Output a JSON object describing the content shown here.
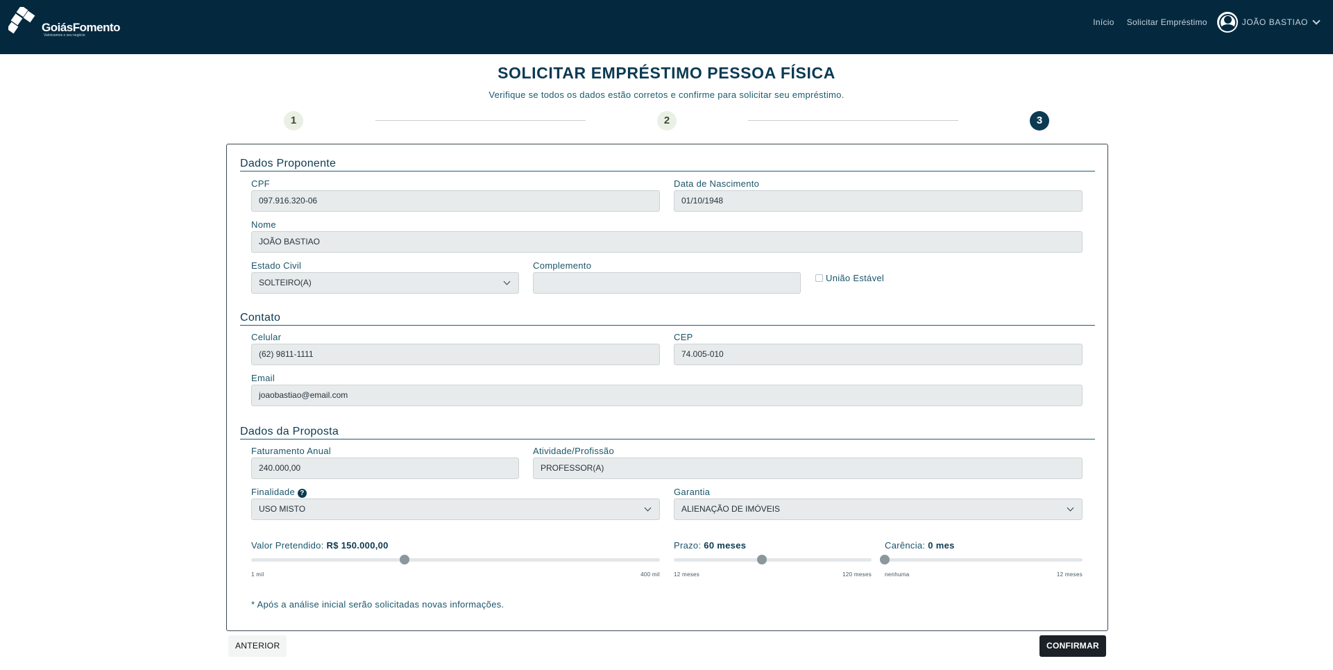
{
  "header": {
    "logo_text": "GoiásFomento",
    "logo_tagline": "Valorizamos o seu negócio",
    "nav": {
      "home": "Início",
      "request_loan": "Solicitar Empréstimo"
    },
    "user_name": "JOÃO BASTIAO"
  },
  "page": {
    "title": "SOLICITAR EMPRÉSTIMO PESSOA FÍSICA",
    "subtitle": "Verifique se todos os dados estão corretos e confirme para solicitar seu empréstimo."
  },
  "stepper": {
    "steps": [
      "1",
      "2",
      "3"
    ],
    "active": "3"
  },
  "proponente": {
    "section_title": "Dados Proponente",
    "cpf_label": "CPF",
    "cpf": "097.916.320-06",
    "nascimento_label": "Data de Nascimento",
    "nascimento": "01/10/1948",
    "nome_label": "Nome",
    "nome": "JOÃO BASTIAO",
    "estado_civil_label": "Estado Civil",
    "estado_civil": "SOLTEIRO(A)",
    "complemento_label": "Complemento",
    "complemento": "",
    "uniao_estavel_label": "União Estável"
  },
  "contato": {
    "section_title": "Contato",
    "celular_label": "Celular",
    "celular": "(62) 9811-1111",
    "cep_label": "CEP",
    "cep": "74.005-010",
    "email_label": "Email",
    "email": "joaobastiao@email.com"
  },
  "proposta": {
    "section_title": "Dados da Proposta",
    "faturamento_label": "Faturamento Anual",
    "faturamento": "240.000,00",
    "atividade_label": "Atividade/Profissão",
    "atividade": "PROFESSOR(A)",
    "finalidade_label": "Finalidade",
    "finalidade": "USO MISTO",
    "garantia_label": "Garantia",
    "garantia": "ALIENAÇÃO DE IMÓVEIS",
    "valor_label": "Valor Pretendido:",
    "valor": "R$ 150.000,00",
    "valor_min": "1 mil",
    "valor_max": "400 mil",
    "valor_position": 0.375,
    "prazo_label": "Prazo:",
    "prazo": "60 meses",
    "prazo_min": "12 meses",
    "prazo_max": "120 meses",
    "prazo_position": 0.444,
    "carencia_label": "Carência:",
    "carencia": "0 mes",
    "carencia_min": "nenhuma",
    "carencia_max": "12 meses",
    "carencia_position": 0.0,
    "note": "* Após a análise inicial serão solicitadas novas informações."
  },
  "buttons": {
    "previous": "ANTERIOR",
    "confirm": "CONFIRMAR"
  }
}
